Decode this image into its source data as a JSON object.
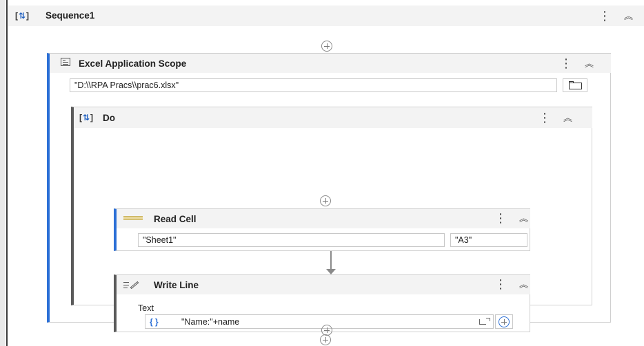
{
  "sequence": {
    "title": "Sequence1"
  },
  "excel_scope": {
    "title": "Excel Application Scope",
    "path_value": "\"D:\\\\RPA Pracs\\\\prac6.xlsx\""
  },
  "do_block": {
    "title": "Do"
  },
  "read_cell": {
    "title": "Read Cell",
    "sheet_value": "\"Sheet1\"",
    "cell_value": "\"A3\""
  },
  "write_line": {
    "title": "Write Line",
    "text_label": "Text",
    "text_value": "\"Name:\"+name",
    "expr_badge": "{ }"
  },
  "icons": [
    "sequence-icon",
    "excel-scope-icon",
    "folder-icon",
    "read-cell-icon",
    "write-line-icon",
    "kebab-icon",
    "collapse-chevron-icon",
    "add-activity-icon",
    "expand-editor-icon",
    "add-argument-icon"
  ],
  "colors": {
    "accent_blue": "#1a73e8",
    "selected_border": "#2b6fd6",
    "panel_bg": "#f5f5f5"
  }
}
